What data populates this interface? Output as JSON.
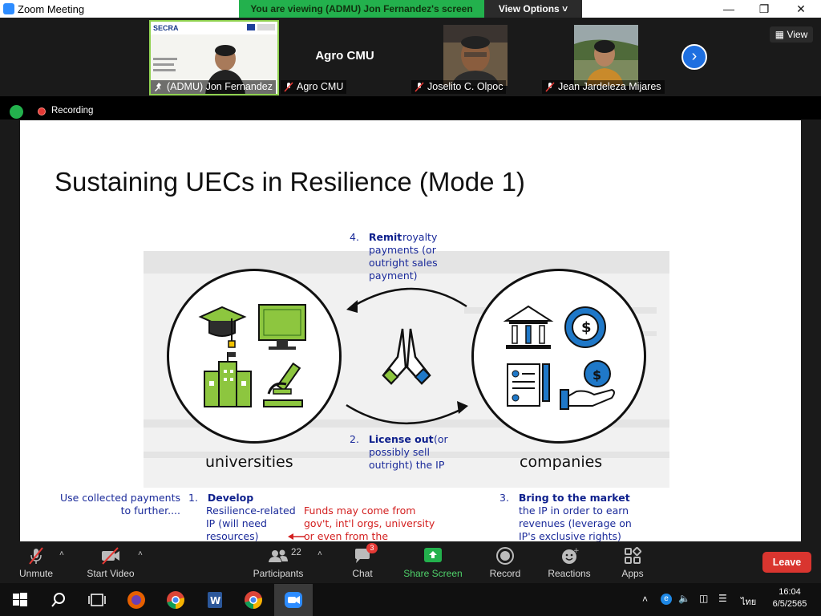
{
  "window": {
    "title": "Zoom Meeting",
    "viewing_banner": "You are viewing (ADMU) Jon Fernandez's screen",
    "view_options": "View Options",
    "view_toggle": "View"
  },
  "participants": [
    {
      "name": "(ADMU) Jon Fernandez",
      "muted": false,
      "active": true
    },
    {
      "name": "Agro CMU",
      "muted": true,
      "display": "Agro CMU"
    },
    {
      "name": "Joselito C. Olpoc",
      "muted": true
    },
    {
      "name": "Jean Jardeleza Mijares",
      "muted": true
    }
  ],
  "recording": {
    "label": "Recording"
  },
  "slide": {
    "title": "Sustaining UECs in Resilience (Mode 1)",
    "left_label": "universities",
    "right_label": "companies",
    "step4": {
      "num": "4.",
      "bold": "Remit",
      "rest": "royalty payments (or outright sales payment)"
    },
    "step2": {
      "num": "2.",
      "bold": "License out",
      "rest": "(or possibly sell outright) the IP"
    },
    "step1": {
      "num": "1.",
      "bold": "Develop",
      "rest": "Resilience-related IP (will need resources)"
    },
    "step3": {
      "num": "3.",
      "bold": "Bring to the market",
      "rest": "the IP in order to earn revenues (leverage on IP's exclusive rights)"
    },
    "left_note": "Use collected payments to further....",
    "red_note": "Funds may come from gov't, int'l orgs, university or even from the",
    "thumb_title": "SECRA"
  },
  "toolbar": {
    "unmute": "Unmute",
    "start_video": "Start Video",
    "participants": "Participants",
    "participants_count": "22",
    "chat": "Chat",
    "chat_badge": "3",
    "share_screen": "Share Screen",
    "record": "Record",
    "reactions": "Reactions",
    "apps": "Apps",
    "leave": "Leave"
  },
  "taskbar": {
    "time": "16:04",
    "date": "6/5/2565",
    "lang": "ไทย"
  },
  "colors": {
    "share_green": "#23b14d",
    "leave_red": "#d9352f",
    "slide_blue": "#1a2a9a",
    "slide_red": "#d32020",
    "icon_green": "#8dc63f",
    "icon_blue": "#1f78c8"
  }
}
